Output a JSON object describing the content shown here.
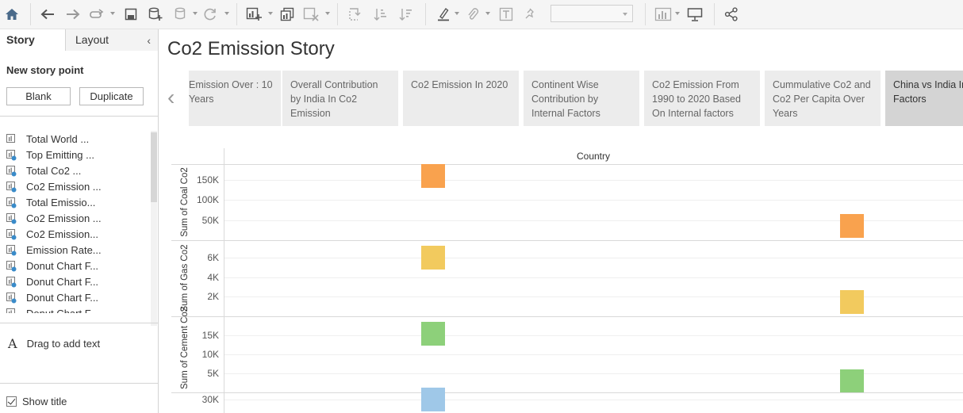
{
  "toolbar": {
    "icons": [
      "home-icon",
      "undo-icon",
      "redo-icon",
      "redirect-icon",
      "save-icon",
      "new-datasource-icon",
      "datasource-icon",
      "refresh-icon",
      "new-worksheet-icon",
      "duplicate-icon",
      "clear-icon",
      "swap-icon",
      "sort-ascending-icon",
      "sort-descending-icon",
      "highlight-icon",
      "attach-icon",
      "text-icon",
      "pin-icon",
      "show-me-icon",
      "presentation-icon",
      "share-icon"
    ],
    "fit_value": ""
  },
  "sidebar": {
    "tab_story": "Story",
    "tab_layout": "Layout",
    "new_story_point": "New story point",
    "blank_button": "Blank",
    "duplicate_button": "Duplicate",
    "sheets": [
      "Total World ...",
      "Top Emitting ...",
      "Total Co2 ...",
      "Co2 Emission ...",
      "Total Emissio...",
      "Co2 Emission ...",
      "Co2 Emission...",
      "Emission Rate...",
      "Donut Chart F...",
      "Donut Chart F...",
      "Donut Chart F...",
      "Donut Chart F..."
    ],
    "drag_text": "Drag to add text",
    "show_title": "Show title"
  },
  "story": {
    "title": "Co2 Emission Story",
    "points": [
      "Emission Over : 10 Years",
      "Overall Contribution by India In Co2 Emission",
      "Co2 Emission In 2020",
      "Continent Wise Contribution by Internal Factors",
      "Co2 Emission From 1990 to 2020 Based On Internal factors",
      "Cummulative Co2 and Co2 Per Capita Over Years",
      "China vs India Internal Factors"
    ]
  },
  "chart_data": {
    "type": "bar",
    "header": "Country",
    "categories": [
      "",
      ""
    ],
    "panes": [
      {
        "ylabel": "Sum of Coal Co2",
        "ticks": [
          "150K",
          "100K",
          "50K"
        ],
        "values": [
          160000,
          35000
        ],
        "color": "#f9a24e"
      },
      {
        "ylabel": "Sum of Gas Co2",
        "ticks": [
          "6K",
          "4K",
          "2K"
        ],
        "values": [
          6000,
          1500
        ],
        "color": "#f2ca5e"
      },
      {
        "ylabel": "Sum of Cement Co2",
        "ticks": [
          "15K",
          "10K",
          "5K"
        ],
        "values": [
          15500,
          3000
        ],
        "color": "#8dd07a"
      },
      {
        "ylabel": "",
        "ticks": [
          "30K"
        ],
        "values": [
          30000,
          null
        ],
        "color": "#9fc8e8"
      }
    ]
  }
}
